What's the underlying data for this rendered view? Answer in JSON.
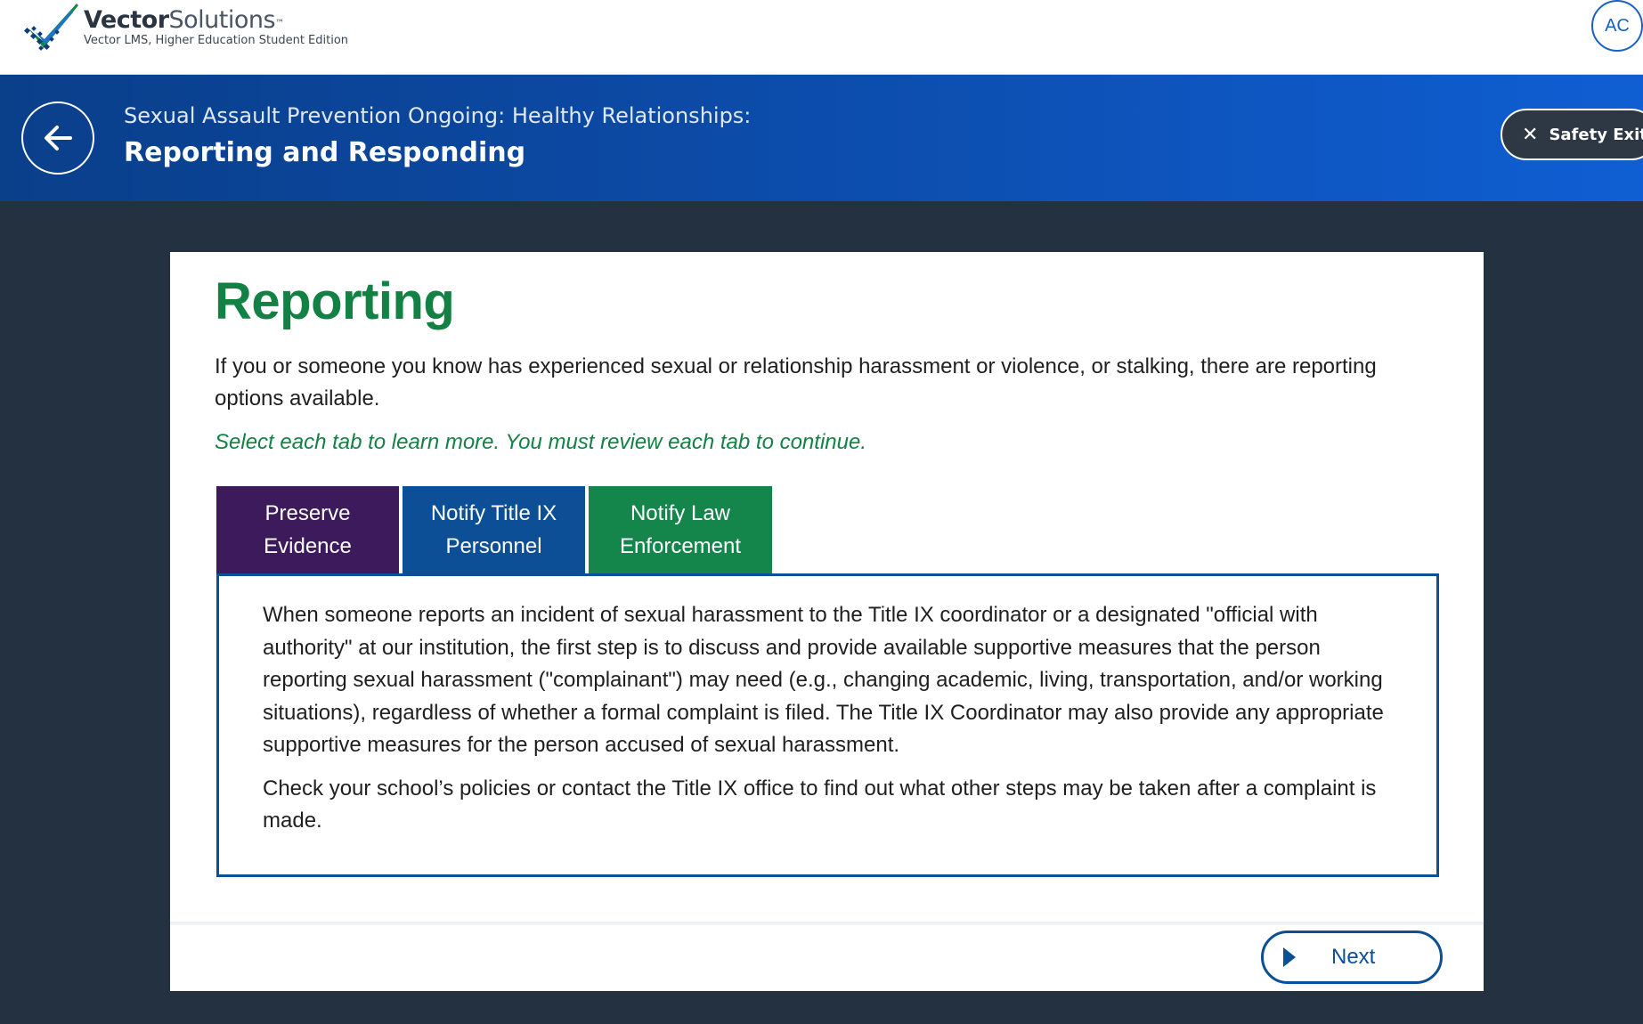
{
  "header": {
    "logo": {
      "brand_bold": "Vector",
      "brand_light": "Solutions",
      "trademark": "™",
      "tagline": "Vector LMS, Higher Education Student Edition"
    },
    "avatar_initials": "AC"
  },
  "course_banner": {
    "back_icon": "arrow-left-icon",
    "subtitle": "Sexual Assault Prevention Ongoing: Healthy Relationships:",
    "title": "Reporting and Responding",
    "safety_exit": {
      "icon": "close-icon",
      "label": "Safety Exit"
    }
  },
  "content": {
    "heading": "Reporting",
    "intro": "If you or someone you know has experienced sexual or relationship harassment or violence, or stalking, there are reporting options available.",
    "instructions": "Select each tab to learn more. You must review each tab to continue.",
    "tabs": [
      {
        "label": "Preserve Evidence",
        "color": "#3d1a5c"
      },
      {
        "label": "Notify Title IX Personnel",
        "color": "#0d4f96"
      },
      {
        "label": "Notify Law Enforcement",
        "color": "#14864b"
      }
    ],
    "panel": {
      "paragraphs": [
        "When someone reports an incident of sexual harassment to the Title IX coordinator or a designated \"official with authority\" at our institution, the first step is to discuss and provide available supportive measures that the person reporting sexual harassment (\"complainant\") may need (e.g., changing academic, living, transportation, and/or working situations), regardless of whether a formal complaint is filed. The Title IX Coordinator may also provide any appropriate supportive measures for the person accused of sexual harassment.",
        "Check your school’s policies or contact the Title IX office to find out what other steps may be taken after a complaint is made."
      ]
    },
    "next_button": {
      "icon": "play-icon",
      "label": "Next"
    }
  },
  "colors": {
    "page_background": "#243140",
    "banner_start": "#0a3f8a",
    "banner_end": "#0f5ed3",
    "heading_green": "#138044",
    "accent_blue": "#0c4f96"
  }
}
